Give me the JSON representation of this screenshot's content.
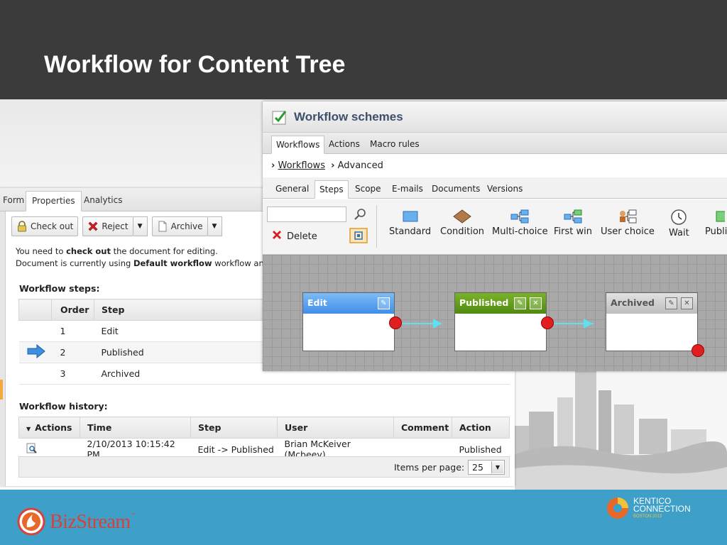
{
  "slide": {
    "title": "Workflow for Content Tree",
    "colors": {
      "header_bg": "#3b3b3b",
      "footer_bg": "#3ea0c8"
    }
  },
  "footer": {
    "bizstream_name": "BizStream",
    "bizstream_tm": "™",
    "kentico_line1": "KENTICO",
    "kentico_line2": "CONNECTION",
    "kentico_line3": "BOSTON 2013"
  },
  "properties_panel": {
    "tabs": [
      "Form",
      "Properties",
      "Analytics"
    ],
    "active_tab": "Properties",
    "toolbar": {
      "check_out": "Check out",
      "reject": "Reject",
      "archive": "Archive"
    },
    "info_line1": {
      "pre": "You need to ",
      "bold": "check out",
      "post": " the document for editing."
    },
    "info_line2": {
      "pre": "Document is currently using ",
      "bold": "Default workflow",
      "post": " workflow and is in l"
    },
    "steps_title": "Workflow steps:",
    "steps_headers": [
      "Order",
      "Step"
    ],
    "steps": [
      {
        "order": "1",
        "step": "Edit",
        "current": false
      },
      {
        "order": "2",
        "step": "Published",
        "current": true
      },
      {
        "order": "3",
        "step": "Archived",
        "current": false
      }
    ],
    "history_title": "Workflow history:",
    "history_headers": [
      "Actions",
      "Time",
      "Step",
      "User",
      "Comment",
      "Action"
    ],
    "history_rows": [
      {
        "time": "2/10/2013 10:15:42 PM",
        "step": "Edit -> Published",
        "user": "Brian McKeiver (Mcbeev)",
        "comment": "",
        "action": "Published"
      }
    ],
    "pager_label": "Items per page:",
    "pager_value": "25"
  },
  "workflow_panel": {
    "title": "Workflow schemes",
    "top_tabs": [
      "Workflows",
      "Actions",
      "Macro rules"
    ],
    "active_top_tab": "Workflows",
    "breadcrumb": {
      "link": "Workflows",
      "current": "Advanced"
    },
    "sub_tabs": [
      "General",
      "Steps",
      "Scope",
      "E-mails",
      "Documents",
      "Versions"
    ],
    "active_sub_tab": "Steps",
    "delete_label": "Delete",
    "step_types": [
      "Standard",
      "Condition",
      "Multi-choice",
      "First win",
      "User choice",
      "Wait",
      "Publi"
    ],
    "nodes": [
      {
        "label": "Edit",
        "color": "#4a9bf0"
      },
      {
        "label": "Published",
        "color": "#5c9a1a"
      },
      {
        "label": "Archived",
        "color": "#c8c8c8"
      }
    ]
  }
}
